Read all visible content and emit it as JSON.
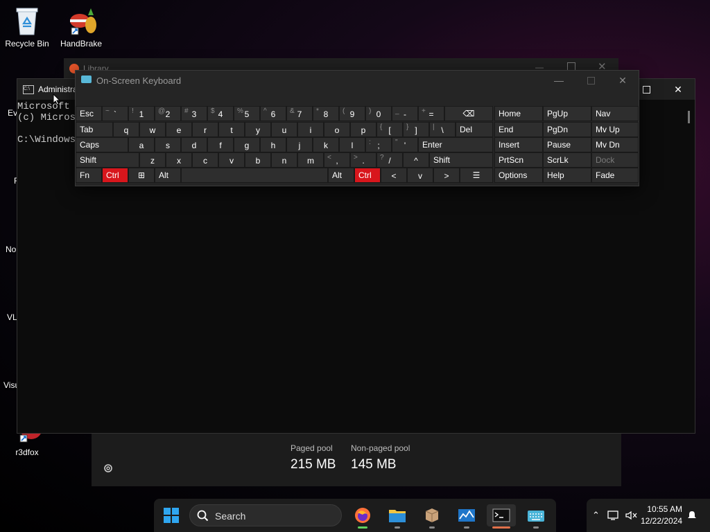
{
  "desktop": {
    "recycle_bin": "Recycle Bin",
    "handbrake": "HandBrake",
    "partial_labels": [
      "Ev",
      "F",
      "No",
      "VL",
      "Visu",
      "r3dfox"
    ]
  },
  "library_window": {
    "title": "Library"
  },
  "task_manager": {
    "paged_pool_label": "Paged pool",
    "paged_pool_value": "215 MB",
    "non_paged_label": "Non-paged pool",
    "non_paged_value": "145 MB"
  },
  "terminal": {
    "title": "Administra",
    "lines": [
      "Microsoft W",
      "(c) Microso",
      "",
      "C:\\Windows\\"
    ]
  },
  "osk": {
    "title": "On-Screen Keyboard",
    "rows": [
      [
        "Esc",
        "`",
        "1",
        "2",
        "3",
        "4",
        "5",
        "6",
        "7",
        "8",
        "9",
        "0",
        "-",
        "=",
        "⌫"
      ],
      [
        "Tab",
        "q",
        "w",
        "e",
        "r",
        "t",
        "y",
        "u",
        "i",
        "o",
        "p",
        "[",
        "]",
        "\\",
        "Del"
      ],
      [
        "Caps",
        "a",
        "s",
        "d",
        "f",
        "g",
        "h",
        "j",
        "k",
        "l",
        ";",
        "'",
        "Enter"
      ],
      [
        "Shift",
        "z",
        "x",
        "c",
        "v",
        "b",
        "n",
        "m",
        ",",
        ".",
        "/",
        "^",
        "Shift"
      ],
      [
        "Fn",
        "Ctrl",
        "⊞",
        "Alt",
        "",
        "Alt",
        "Ctrl",
        "<",
        "v",
        ">",
        "☰"
      ]
    ],
    "shift_row0": [
      "",
      "~",
      "!",
      "@",
      "#",
      "$",
      "%",
      "^",
      "&",
      "*",
      "(",
      ")",
      "_",
      "+",
      ""
    ],
    "shift_row1": [
      "",
      "",
      "",
      "",
      "",
      "",
      "",
      "",
      "",
      "",
      "",
      "{",
      "}",
      "|",
      ""
    ],
    "shift_row2": [
      "",
      "",
      "",
      "",
      "",
      "",
      "",
      "",
      "",
      "",
      ":",
      "\"",
      ""
    ],
    "shift_row3": [
      "",
      "",
      "",
      "",
      "",
      "",
      "",
      "",
      "<",
      ">",
      "?",
      "",
      ""
    ],
    "nav": [
      [
        "Home",
        "PgUp",
        "Nav"
      ],
      [
        "End",
        "PgDn",
        "Mv Up"
      ],
      [
        "Insert",
        "Pause",
        "Mv Dn"
      ],
      [
        "PrtScn",
        "ScrLk",
        "Dock"
      ],
      [
        "Options",
        "Help",
        "Fade"
      ]
    ],
    "ctrl_color": "#d8161c"
  },
  "taskbar": {
    "search_placeholder": "Search",
    "time": "10:55 AM",
    "date": "12/22/2024"
  }
}
